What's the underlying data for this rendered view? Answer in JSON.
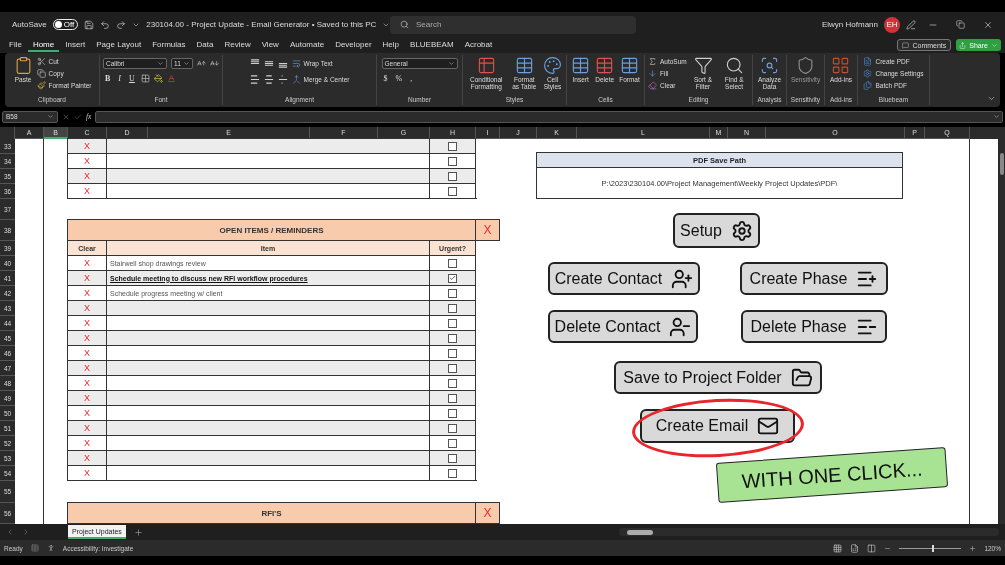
{
  "title_bar": {
    "autosave_label": "AutoSave",
    "autosave": {
      "on": false,
      "label": "Off"
    },
    "document_title": "230104.00 - Project Update - Email Generator • Saved to this PC",
    "search_placeholder": "Search",
    "user_name": "Elwyn Hofmann",
    "user_initials": "EH"
  },
  "menu_tabs": [
    {
      "label": "File",
      "selected": false
    },
    {
      "label": "Home",
      "selected": true
    },
    {
      "label": "Insert",
      "selected": false
    },
    {
      "label": "Page Layout",
      "selected": false
    },
    {
      "label": "Formulas",
      "selected": false
    },
    {
      "label": "Data",
      "selected": false
    },
    {
      "label": "Review",
      "selected": false
    },
    {
      "label": "View",
      "selected": false
    },
    {
      "label": "Automate",
      "selected": false
    },
    {
      "label": "Developer",
      "selected": false
    },
    {
      "label": "Help",
      "selected": false
    },
    {
      "label": "BLUEBEAM",
      "selected": false
    },
    {
      "label": "Acrobat",
      "selected": false
    }
  ],
  "comments_button": "Comments",
  "share_button": "Share",
  "ribbon_groups": [
    {
      "title": "Clipboard",
      "disabled": false,
      "items": [
        {
          "kind": "large",
          "label": "Paste"
        },
        {
          "kind": "small",
          "label": "Cut"
        },
        {
          "kind": "small",
          "label": "Copy"
        },
        {
          "kind": "small",
          "label": "Format Painter"
        }
      ]
    },
    {
      "title": "Font",
      "disabled": false,
      "lines": [
        {
          "items": [
            {
              "kind": "field",
              "value": "Calibri"
            },
            {
              "kind": "field",
              "value": "11"
            }
          ]
        },
        {
          "items": [
            {
              "kind": "glyph",
              "label": "B"
            },
            {
              "kind": "glyph",
              "label": "I"
            },
            {
              "kind": "glyph",
              "label": "U"
            }
          ]
        }
      ]
    },
    {
      "title": "Alignment",
      "disabled": false,
      "lines": [
        {
          "items": [
            {
              "kind": "small",
              "label": "Wrap Text"
            }
          ]
        },
        {
          "items": [
            {
              "kind": "small",
              "label": "Merge & Center"
            }
          ]
        }
      ]
    },
    {
      "title": "Number",
      "disabled": false,
      "lines": [
        {
          "items": [
            {
              "kind": "field",
              "value": "General"
            }
          ]
        },
        {
          "items": [
            {
              "kind": "glyph",
              "label": "$"
            },
            {
              "kind": "glyph",
              "label": "%"
            },
            {
              "kind": "glyph",
              "label": ","
            }
          ]
        }
      ]
    },
    {
      "title": "Styles",
      "disabled": false,
      "items": [
        {
          "kind": "large",
          "label": "Conditional Formatting"
        },
        {
          "kind": "large",
          "label": "Format as Table"
        },
        {
          "kind": "large",
          "label": "Cell Styles"
        }
      ]
    },
    {
      "title": "Cells",
      "disabled": false,
      "items": [
        {
          "kind": "large",
          "label": "Insert"
        },
        {
          "kind": "large",
          "label": "Delete"
        },
        {
          "kind": "large",
          "label": "Format"
        }
      ]
    },
    {
      "title": "Editing",
      "disabled": false,
      "items": [
        {
          "kind": "small",
          "label": "AutoSum"
        },
        {
          "kind": "small",
          "label": "Fill"
        },
        {
          "kind": "small",
          "label": "Clear"
        },
        {
          "kind": "large",
          "label": "Sort & Filter"
        },
        {
          "kind": "large",
          "label": "Find & Select"
        }
      ]
    },
    {
      "title": "Analysis",
      "disabled": false,
      "items": [
        {
          "kind": "large",
          "label": "Analyze Data"
        }
      ]
    },
    {
      "title": "Sensitivity",
      "disabled": true,
      "items": [
        {
          "kind": "large",
          "label": "Sensitivity"
        }
      ]
    },
    {
      "title": "Add-ins",
      "disabled": false,
      "items": [
        {
          "kind": "large",
          "label": "Add-ins"
        }
      ]
    },
    {
      "title": "Bluebeam",
      "disabled": false,
      "items": [
        {
          "kind": "small",
          "label": "Create PDF"
        },
        {
          "kind": "small",
          "label": "Change Settings"
        },
        {
          "kind": "small",
          "label": "Batch PDF"
        }
      ]
    }
  ],
  "formula_bar": {
    "name_box": "B58",
    "fx": "fx"
  },
  "columns": [
    {
      "label": "A",
      "selected": false
    },
    {
      "label": "B",
      "selected": true
    },
    {
      "label": "C",
      "selected": false
    },
    {
      "label": "D",
      "selected": false
    },
    {
      "label": "E",
      "selected": false
    },
    {
      "label": "F",
      "selected": false
    },
    {
      "label": "G",
      "selected": false
    },
    {
      "label": "H",
      "selected": false
    },
    {
      "label": "I",
      "selected": false
    },
    {
      "label": "J",
      "selected": false
    },
    {
      "label": "K",
      "selected": false
    },
    {
      "label": "L",
      "selected": false
    },
    {
      "label": "M",
      "selected": false
    },
    {
      "label": "N",
      "selected": false
    },
    {
      "label": "O",
      "selected": false
    },
    {
      "label": "P",
      "selected": false
    },
    {
      "label": "Q",
      "selected": false
    }
  ],
  "row_numbers": [
    "33",
    "34",
    "35",
    "36",
    "37",
    "38",
    "39",
    "40",
    "41",
    "42",
    "43",
    "44",
    "45",
    "46",
    "47",
    "48",
    "49",
    "50",
    "51",
    "52",
    "53",
    "54",
    "55",
    "56"
  ],
  "upper_table": {
    "rows": [
      {
        "clear": "X",
        "urgent": false
      },
      {
        "clear": "X",
        "urgent": false
      },
      {
        "clear": "X",
        "urgent": false
      },
      {
        "clear": "X",
        "urgent": false
      }
    ]
  },
  "open_items": {
    "title": "OPEN ITEMS / REMINDERS",
    "close": "X",
    "columns": [
      "Clear",
      "Item",
      "Urgent?"
    ],
    "rows": [
      {
        "clear": "X",
        "item": "Stairwell shop drawings review",
        "urgent": false,
        "emphasized": false
      },
      {
        "clear": "X",
        "item": "Schedule meeting to discuss new RFI workflow procedures",
        "urgent": true,
        "emphasized": true
      },
      {
        "clear": "X",
        "item": "Schedule progress meeting w/ client",
        "urgent": false,
        "emphasized": false
      },
      {
        "clear": "X",
        "urgent": false,
        "emphasized": false
      },
      {
        "clear": "X",
        "urgent": false,
        "emphasized": false
      },
      {
        "clear": "X",
        "urgent": false,
        "emphasized": false
      },
      {
        "clear": "X",
        "urgent": false,
        "emphasized": false
      },
      {
        "clear": "X",
        "urgent": false,
        "emphasized": false
      },
      {
        "clear": "X",
        "urgent": false,
        "emphasized": false
      },
      {
        "clear": "X",
        "urgent": false,
        "emphasized": false
      },
      {
        "clear": "X",
        "urgent": false,
        "emphasized": false
      },
      {
        "clear": "X",
        "urgent": false,
        "emphasized": false
      },
      {
        "clear": "X",
        "urgent": false,
        "emphasized": false
      },
      {
        "clear": "X",
        "urgent": false,
        "emphasized": false
      },
      {
        "clear": "X",
        "urgent": false,
        "emphasized": false
      }
    ]
  },
  "rfi": {
    "title": "RFI'S",
    "close": "X"
  },
  "pdf_save_path": {
    "title": "PDF Save Path",
    "path": "P:\\2023\\230104.00\\Project Management\\Weekly Project Updates\\PDF\\"
  },
  "macro_button_rows": [
    {
      "buttons": [
        {
          "label": "Setup",
          "circled": false
        }
      ]
    },
    {
      "buttons": [
        {
          "label": "Create Contact",
          "circled": false
        },
        {
          "label": "Create Phase",
          "circled": false
        }
      ]
    },
    {
      "buttons": [
        {
          "label": "Delete Contact",
          "circled": false
        },
        {
          "label": "Delete Phase",
          "circled": false
        }
      ]
    },
    {
      "buttons": [
        {
          "label": "Save to Project Folder",
          "circled": false
        }
      ]
    },
    {
      "buttons": [
        {
          "label": "Create Email",
          "circled": true
        }
      ]
    }
  ],
  "callout": "WITH ONE CLICK...",
  "sheet_tabs": [
    {
      "label": "Project Updates",
      "selected": true
    }
  ],
  "status_bar": {
    "status": "Ready",
    "accessibility": "Accessibility: Investigate",
    "zoom_slider": {
      "level": 0.52
    },
    "zoom": "120%"
  }
}
